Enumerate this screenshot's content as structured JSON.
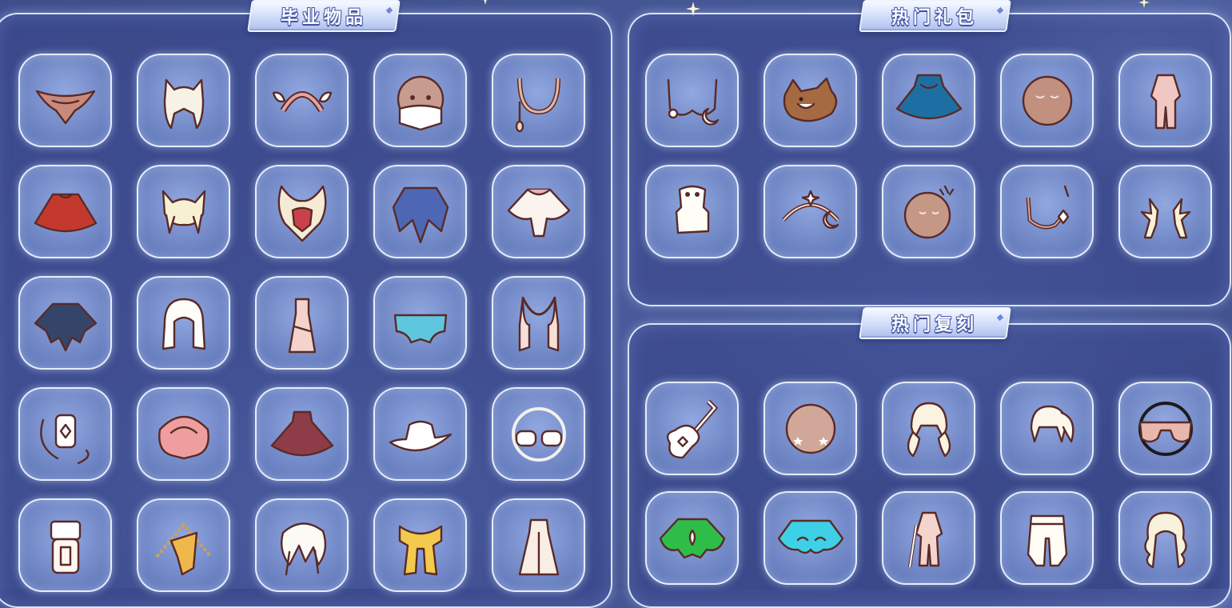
{
  "sections": {
    "graduation": {
      "title": "毕业物品"
    },
    "hot_gifts": {
      "title": "热门礼包"
    },
    "hot_rerun": {
      "title": "热门复刻"
    }
  },
  "colors": {
    "panel_border": "#e8f0ff",
    "panel_fill": "#38468a",
    "slot_fill": "#8ea4dc",
    "banner_fill": "#cfdcf9"
  },
  "graduation_items": [
    {
      "name": "wing-cape-icon"
    },
    {
      "name": "ears-hair-icon"
    },
    {
      "name": "winged-headband-icon"
    },
    {
      "name": "masked-face-icon"
    },
    {
      "name": "necklace-pendant-icon"
    },
    {
      "name": "red-cape-icon"
    },
    {
      "name": "pigtail-hair-icon"
    },
    {
      "name": "owl-mask-icon"
    },
    {
      "name": "blue-cape-icon"
    },
    {
      "name": "white-wing-cape-icon"
    },
    {
      "name": "dark-layered-cape-icon"
    },
    {
      "name": "long-hair-icon"
    },
    {
      "name": "dress-outfit-icon"
    },
    {
      "name": "butterfly-cape-icon"
    },
    {
      "name": "scarf-necklace-icon"
    },
    {
      "name": "charm-prop-icon"
    },
    {
      "name": "shell-cape-icon"
    },
    {
      "name": "maroon-cape-icon"
    },
    {
      "name": "cowboy-hat-icon"
    },
    {
      "name": "round-glasses-icon"
    },
    {
      "name": "lantern-prop-icon"
    },
    {
      "name": "gold-chain-cape-icon"
    },
    {
      "name": "feather-hair-icon"
    },
    {
      "name": "gold-scarf-icon"
    },
    {
      "name": "robe-outfit-icon"
    }
  ],
  "gift_items": [
    {
      "name": "moon-earring-icon"
    },
    {
      "name": "corgi-prop-icon"
    },
    {
      "name": "teal-hood-cape-icon"
    },
    {
      "name": "sleepy-mask-icon"
    },
    {
      "name": "pajama-outfit-icon"
    },
    {
      "name": "shoe-prop-icon"
    },
    {
      "name": "moon-headpiece-icon"
    },
    {
      "name": "star-mask-icon"
    },
    {
      "name": "pendant-necklace-icon"
    },
    {
      "name": "antler-horns-icon"
    }
  ],
  "rerun_items": [
    {
      "name": "ukulele-icon"
    },
    {
      "name": "blush-mask-icon"
    },
    {
      "name": "twin-tail-hair-icon"
    },
    {
      "name": "ponytail-hair-icon"
    },
    {
      "name": "sunglasses-icon"
    },
    {
      "name": "green-cape-icon"
    },
    {
      "name": "cloud-cape-icon"
    },
    {
      "name": "sword-outfit-icon"
    },
    {
      "name": "pants-icon"
    },
    {
      "name": "wavy-hair-icon"
    }
  ]
}
